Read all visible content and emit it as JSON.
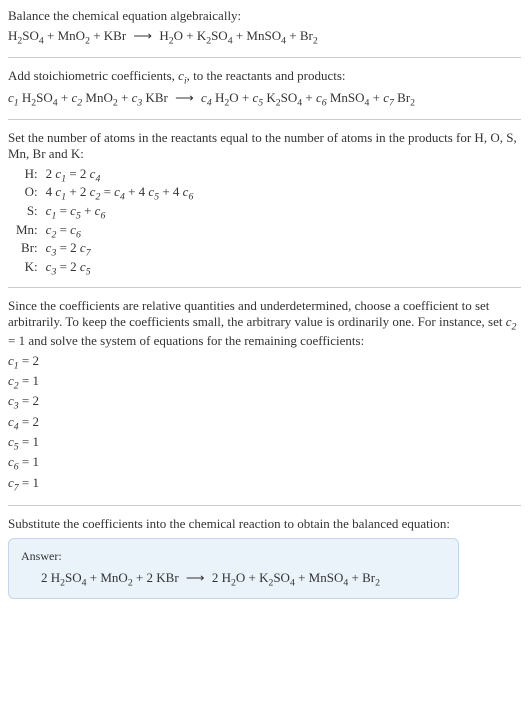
{
  "intro": {
    "line1": "Balance the chemical equation algebraically:"
  },
  "step2": {
    "line1_a": "Add stoichiometric coefficients, ",
    "line1_b": ", to the reactants and products:"
  },
  "step3": {
    "line1": "Set the number of atoms in the reactants equal to the number of atoms in the products for H, O, S, Mn, Br and K:",
    "atoms": [
      {
        "label": "H:",
        "lhs_a": "2",
        "lhs_b": " = 2",
        "var_l": "c",
        "sub_l": "1",
        "var_r": "c",
        "sub_r": "4"
      },
      {
        "label": "O:"
      },
      {
        "label": "S:"
      },
      {
        "label": "Mn:"
      },
      {
        "label": "Br:"
      },
      {
        "label": "K:"
      }
    ]
  },
  "step4": {
    "text_a": "Since the coefficients are relative quantities and underdetermined, choose a coefficient to set arbitrarily. To keep the coefficients small, the arbitrary value is ordinarily one. For instance, set ",
    "text_b": " = 1 and solve the system of equations for the remaining coefficients:",
    "coeffs": [
      {
        "v": "c",
        "s": "1",
        "eq": " = 2"
      },
      {
        "v": "c",
        "s": "2",
        "eq": " = 1"
      },
      {
        "v": "c",
        "s": "3",
        "eq": " = 2"
      },
      {
        "v": "c",
        "s": "4",
        "eq": " = 2"
      },
      {
        "v": "c",
        "s": "5",
        "eq": " = 1"
      },
      {
        "v": "c",
        "s": "6",
        "eq": " = 1"
      },
      {
        "v": "c",
        "s": "7",
        "eq": " = 1"
      }
    ]
  },
  "step5": {
    "line1": "Substitute the coefficients into the chemical reaction to obtain the balanced equation:"
  },
  "answer": {
    "label": "Answer:"
  },
  "chem": {
    "H2SO4": {
      "a": "H",
      "as": "2",
      "b": "SO",
      "bs": "4"
    },
    "MnO2": {
      "a": "MnO",
      "as": "2"
    },
    "KBr": {
      "a": "KBr"
    },
    "H2O": {
      "a": "H",
      "as": "2",
      "b": "O"
    },
    "K2SO4": {
      "a": "K",
      "as": "2",
      "b": "SO",
      "bs": "4"
    },
    "MnSO4": {
      "a": "MnSO",
      "as": "4"
    },
    "Br2": {
      "a": "Br",
      "as": "2"
    }
  },
  "sym": {
    "plus": " + ",
    "arrow": "⟶",
    "c": "c",
    "ci": "i",
    "twosp": "2 "
  },
  "cnum": {
    "1": "1",
    "2": "2",
    "3": "3",
    "4": "4",
    "5": "5",
    "6": "6",
    "7": "7"
  },
  "atoms_eq": {
    "H": {
      "pre": "2 ",
      "c1": "1",
      "mid": " = 2 ",
      "c2": "4"
    },
    "O": {
      "p1": "4 ",
      "c1": "1",
      "p2": " + 2 ",
      "c2": "2",
      "p3": " = ",
      "c3": "4",
      "p4": " + 4 ",
      "c4": "5",
      "p5": " + 4 ",
      "c5": "6"
    },
    "S": {
      "c1": "1",
      "p1": " = ",
      "c2": "5",
      "p2": " + ",
      "c3": "6"
    },
    "Mn": {
      "c1": "2",
      "p1": " = ",
      "c2": "6"
    },
    "Br": {
      "c1": "3",
      "p1": " = 2 ",
      "c2": "7"
    },
    "K": {
      "c1": "3",
      "p1": " = 2 ",
      "c2": "5"
    }
  }
}
